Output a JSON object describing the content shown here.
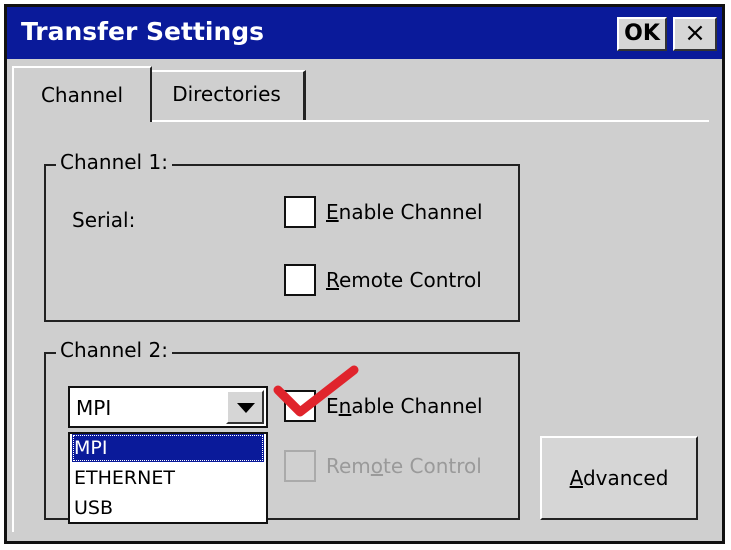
{
  "window": {
    "title": "Transfer Settings",
    "ok_label": "OK",
    "close_label": "×"
  },
  "tabs": [
    {
      "label": "Channel",
      "active": true
    },
    {
      "label": "Directories",
      "active": false
    }
  ],
  "channel1": {
    "legend": "Channel 1:",
    "type_label": "Serial:",
    "enable": {
      "accel": "E",
      "rest": "nable Channel",
      "checked": false
    },
    "remote": {
      "accel": "R",
      "rest": "emote Control",
      "checked": false
    }
  },
  "channel2": {
    "legend": "Channel 2:",
    "selected_value": "MPI",
    "options": [
      "MPI",
      "ETHERNET",
      "USB"
    ],
    "enable": {
      "pre": "E",
      "accel": "n",
      "rest": "able Channel",
      "checked": true
    },
    "remote": {
      "pre": "Rem",
      "accel": "o",
      "rest": "te Control",
      "checked": false,
      "disabled": true
    }
  },
  "advanced": {
    "accel": "A",
    "rest": "dvanced"
  },
  "colors": {
    "title_bar": "#0a1a9a",
    "window_bg": "#cfcfcf",
    "checkmark": "#e0242c"
  },
  "icons": {
    "dropdown": "chevron-down-icon",
    "close": "close-icon",
    "annotation": "checkmark-annotation-icon"
  }
}
